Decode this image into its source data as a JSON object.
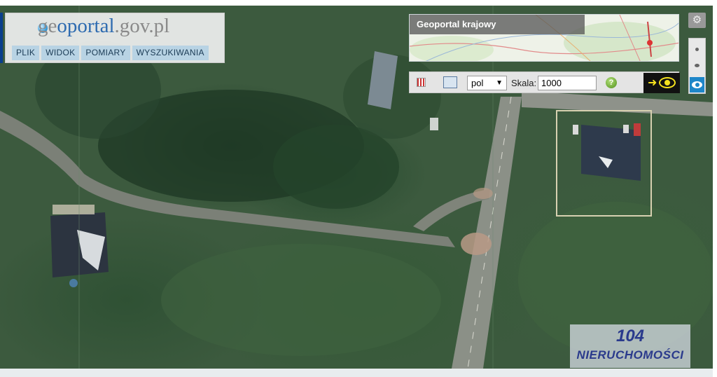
{
  "app": {
    "logo_prefix": "ge",
    "logo_accent": "oportal",
    "logo_suffix": ".gov.pl",
    "menu": [
      "PLIK",
      "WIDOK",
      "POMIARY",
      "WYSZUKIWANIA"
    ]
  },
  "overview": {
    "title": "Geoportal krajowy"
  },
  "toolbar": {
    "grid_icon": "grid-icon",
    "wms_icon": "wms-icon",
    "language_value": "pol",
    "scale_label": "Skala:",
    "scale_value": "1000",
    "help_label": "?",
    "help_icon": "help-icon",
    "eye_icon": "eye-icon"
  },
  "controls": {
    "settings_icon": "gear-icon",
    "zoom_panel_icon": "eye-icon"
  },
  "watermark": {
    "number": "104",
    "text": "NIERUCHOMOŚCI"
  },
  "colors": {
    "accent": "#2e6bb0",
    "menu_bg": "#b8d3e4",
    "active_blue": "#1e86c8",
    "eye_yellow": "#f5e21e"
  }
}
